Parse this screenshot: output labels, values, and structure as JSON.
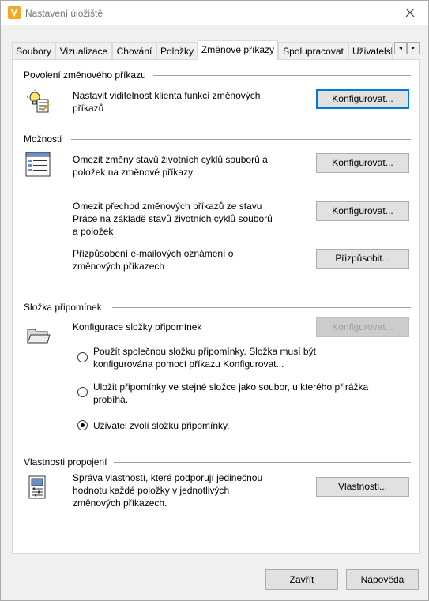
{
  "window": {
    "title": "Nastavení úložiště",
    "app_icon": "vault-v-icon",
    "accent_color": "#f5a623"
  },
  "tabs": [
    {
      "label": "Soubory",
      "active": false
    },
    {
      "label": "Vizualizace",
      "active": false
    },
    {
      "label": "Chování",
      "active": false
    },
    {
      "label": "Položky",
      "active": false
    },
    {
      "label": "Změnové příkazy",
      "active": true
    },
    {
      "label": "Spolupracovat",
      "active": false
    },
    {
      "label": "Uživatelsk",
      "active": false
    }
  ],
  "tab_scroll": {
    "left": "◂",
    "right": "▸"
  },
  "sections": {
    "enable": {
      "title": "Povolení změnového příkazu",
      "icon": "lightbulb-checklist-icon",
      "description": [
        "Nastavit viditelnost klienta funkcí změnových",
        "příkazů"
      ],
      "button": "Konfigurovat..."
    },
    "options": {
      "title": "Možnosti",
      "icon": "list-form-icon",
      "row1": {
        "description": [
          "Omezit změny stavů životních cyklů souborů a",
          "položek na změnové příkazy"
        ],
        "button": "Konfigurovat..."
      },
      "row2": {
        "description": [
          "Omezit přechod změnových příkazů ze stavu",
          "Práce na základě stavů životních cyklů souborů",
          "a položek"
        ],
        "button": "Konfigurovat..."
      },
      "row3": {
        "description": [
          "Přizpůsobení e-mailových oznámení o",
          "změnových příkazech"
        ],
        "button": "Přizpůsobit..."
      }
    },
    "markup": {
      "title": "Složka připomínek",
      "icon": "folder-open-icon",
      "label": "Konfigurace složky připomínek",
      "button": "Konfigurovat...",
      "button_disabled": true,
      "radios": [
        {
          "lines": [
            "Použít společnou složku připomínky. Složka musí být",
            "konfigurována pomocí příkazu Konfigurovat..."
          ],
          "checked": false
        },
        {
          "lines": [
            "Uložit připomínky ve stejné složce jako soubor, u kterého přirážka",
            "probíhá."
          ],
          "checked": false
        },
        {
          "lines": [
            "Uživatel zvolí složku připomínky."
          ],
          "checked": true
        }
      ]
    },
    "link": {
      "title": "Vlastnosti propojení",
      "icon": "properties-sheet-icon",
      "description": [
        "Správa vlastností, které podporují jedinečnou",
        "hodnotu každé položky v jednotlivých",
        "změnových příkazech."
      ],
      "button": "Vlastnosti..."
    }
  },
  "footer": {
    "close": "Zavřít",
    "help": "Nápověda"
  }
}
